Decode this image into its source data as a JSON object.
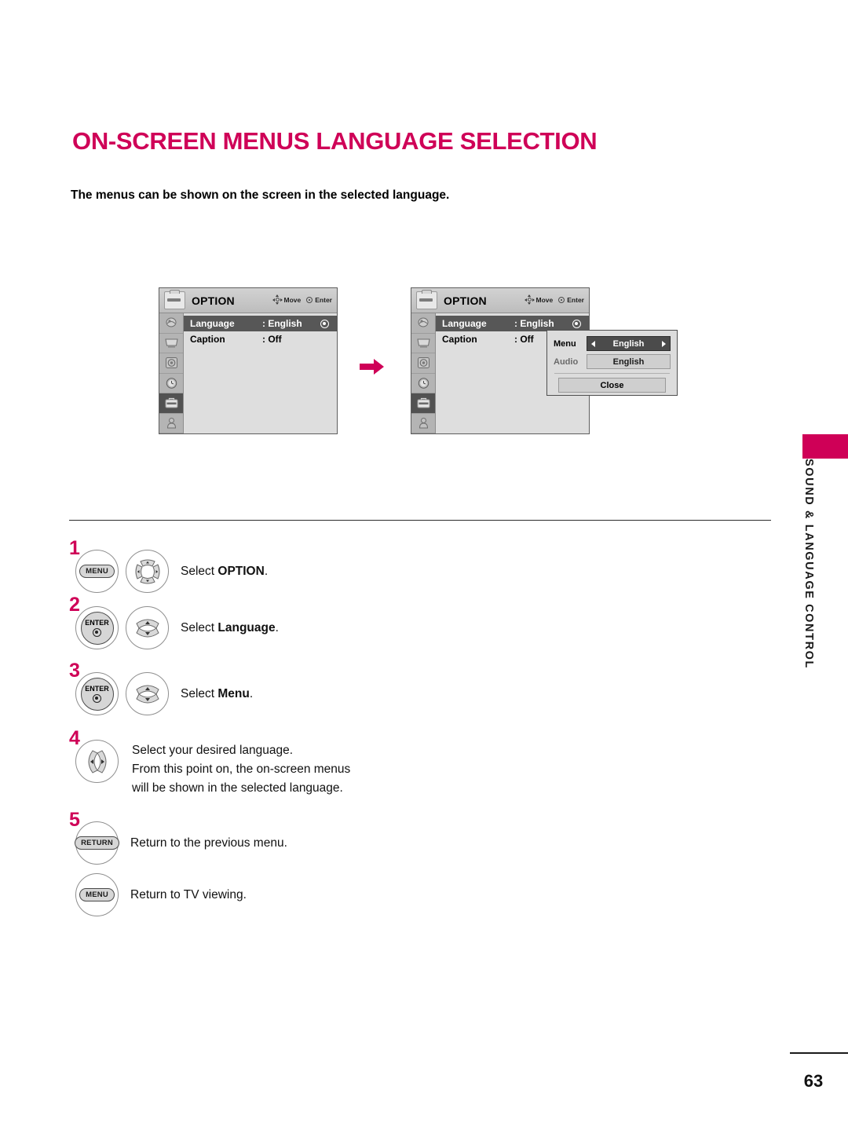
{
  "page": {
    "title": "ON-SCREEN MENUS LANGUAGE SELECTION",
    "subtitle": "The menus can be shown on the screen in the selected language.",
    "number": "63",
    "accent_color": "#cf0057"
  },
  "side_tab": {
    "label": "SOUND & LANGUAGE CONTROL"
  },
  "osd_menus": [
    {
      "title": "OPTION",
      "hints": [
        {
          "icon": "dpad-icon",
          "label": "Move"
        },
        {
          "icon": "enter-circle-icon",
          "label": "Enter"
        }
      ],
      "sidebar_icons": [
        "picture-icon",
        "display-icon",
        "audio-icon",
        "time-icon",
        "option-icon",
        "lock-icon"
      ],
      "active_sidebar_index": 4,
      "rows": [
        {
          "label": "Language",
          "value": ": English",
          "selected": true,
          "radio": true
        },
        {
          "label": "Caption",
          "value": ": Off",
          "selected": false,
          "radio": false
        }
      ]
    },
    {
      "title": "OPTION",
      "hints": [
        {
          "icon": "dpad-icon",
          "label": "Move"
        },
        {
          "icon": "enter-circle-icon",
          "label": "Enter"
        }
      ],
      "sidebar_icons": [
        "picture-icon",
        "display-icon",
        "audio-icon",
        "time-icon",
        "option-icon",
        "lock-icon"
      ],
      "active_sidebar_index": 4,
      "rows": [
        {
          "label": "Language",
          "value": ": English",
          "selected": true,
          "radio": true
        },
        {
          "label": "Caption",
          "value": ": Off",
          "selected": false,
          "radio": false
        }
      ]
    }
  ],
  "language_popup": {
    "menu_label": "Menu",
    "menu_value": "English",
    "audio_label": "Audio",
    "audio_value": "English",
    "close_label": "Close"
  },
  "steps": [
    {
      "number": "1",
      "buttons": [
        "MENU",
        "dpad-4way"
      ],
      "text_prefix": "Select ",
      "text_bold": "OPTION",
      "text_suffix": "."
    },
    {
      "number": "2",
      "buttons": [
        "ENTER",
        "updown-rocker"
      ],
      "text_prefix": "Select ",
      "text_bold": "Language",
      "text_suffix": "."
    },
    {
      "number": "3",
      "buttons": [
        "ENTER",
        "updown-rocker"
      ],
      "text_prefix": "Select ",
      "text_bold": "Menu",
      "text_suffix": "."
    },
    {
      "number": "4",
      "buttons": [
        "leftright-rocker"
      ],
      "lines": [
        "Select your desired language.",
        "From this point on, the on-screen menus",
        "will be shown in the selected language."
      ]
    },
    {
      "number": "5",
      "buttons": [
        "RETURN"
      ],
      "text": "Return to the previous menu."
    },
    {
      "number": "",
      "buttons": [
        "MENU"
      ],
      "text": "Return to TV viewing."
    }
  ],
  "button_labels": {
    "menu": "MENU",
    "enter": "ENTER",
    "return": "RETURN"
  }
}
